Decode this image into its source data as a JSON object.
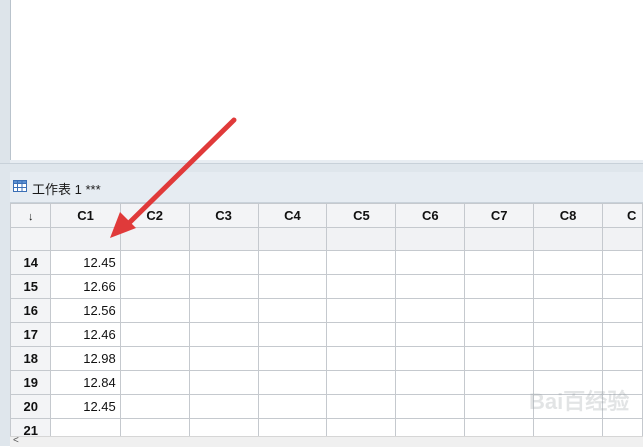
{
  "worksheet": {
    "title": "工作表 1 ***",
    "corner_glyph": "↓",
    "columns": [
      "C1",
      "C2",
      "C3",
      "C4",
      "C5",
      "C6",
      "C7",
      "C8",
      "C"
    ],
    "rows": [
      {
        "row": "14",
        "c1": "12.45"
      },
      {
        "row": "15",
        "c1": "12.66"
      },
      {
        "row": "16",
        "c1": "12.56"
      },
      {
        "row": "17",
        "c1": "12.46"
      },
      {
        "row": "18",
        "c1": "12.98"
      },
      {
        "row": "19",
        "c1": "12.84"
      },
      {
        "row": "20",
        "c1": "12.45"
      },
      {
        "row": "21",
        "c1": ""
      }
    ]
  },
  "scrollbar": {
    "left_glyph": "<"
  },
  "annotation": {
    "color": "#e03a3a"
  },
  "watermark": {
    "text": "Bai百经验"
  },
  "colors": {
    "header_bg": "#f3f4f6",
    "grid_line": "#c5c9ce",
    "title_bar": "#e6ecf2"
  }
}
